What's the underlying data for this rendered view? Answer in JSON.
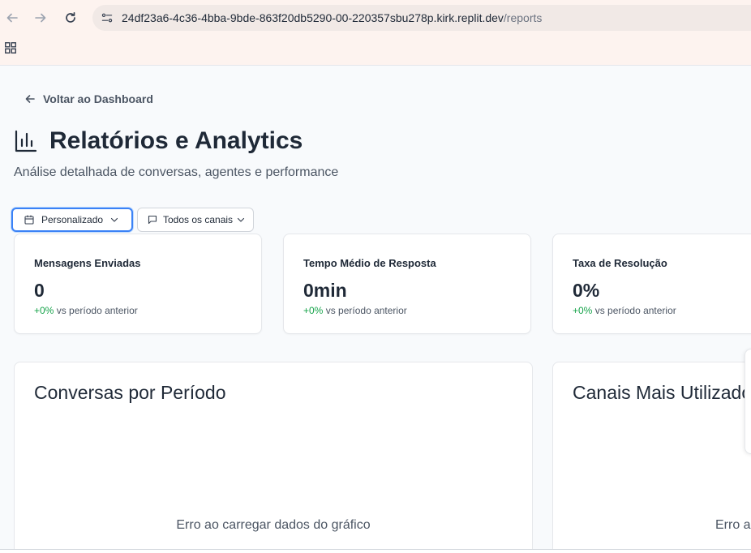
{
  "browser": {
    "url_host": "24df23a6-4c36-4bba-9bde-863f20db5290-00-220357sbu278p.kirk.replit.dev",
    "url_path": "/reports"
  },
  "page": {
    "back_label": "Voltar ao Dashboard",
    "title": "Relatórios e Analytics",
    "subtitle": "Análise detalhada de conversas, agentes e performance"
  },
  "filters": {
    "period": "Personalizado",
    "channel": "Todos os canais"
  },
  "stats": [
    {
      "label": "Mensagens Enviadas",
      "value": "0",
      "change": "+0%",
      "change_suffix": "vs período anterior"
    },
    {
      "label": "Tempo Médio de Resposta",
      "value": "0min",
      "change": "+0%",
      "change_suffix": "vs período anterior"
    },
    {
      "label": "Taxa de Resolução",
      "value": "0%",
      "change": "+0%",
      "change_suffix": "vs período anterior"
    }
  ],
  "charts": [
    {
      "title": "Conversas por Período",
      "message": "Erro ao carregar dados do gráfico"
    },
    {
      "title": "Canais Mais Utilizado",
      "message": "Erro a"
    }
  ],
  "colors": {
    "accent": "#3b82f6",
    "positive": "#16a34a",
    "text": "#1f2937"
  }
}
